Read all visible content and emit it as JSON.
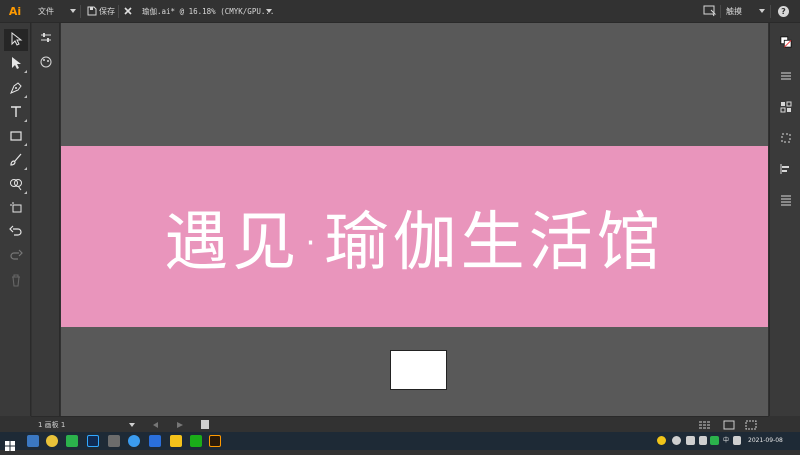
{
  "app": {
    "logo": "Ai"
  },
  "menubar": {
    "file_label": "文件",
    "save_label": "保存",
    "doc_title": "瑜伽.ai* @ 16.18% (CMYK/GPU...",
    "workspace_label": "触摸",
    "help_label": "?"
  },
  "canvas": {
    "banner_text": "遇见·瑜伽生活馆",
    "banner_color": "#e995bc",
    "canvas_color": "#595959"
  },
  "statusbar": {
    "artboard_label": "1 画板 1"
  },
  "taskbar": {
    "ime_label": "中",
    "date_label": "2021-09-08"
  },
  "tools": [
    "selection-icon",
    "direct-selection-icon",
    "pen-icon",
    "type-icon",
    "rectangle-icon",
    "paintbrush-icon",
    "shape-builder-icon",
    "artboard-icon",
    "undo-icon",
    "redo-icon",
    "delete-icon"
  ]
}
